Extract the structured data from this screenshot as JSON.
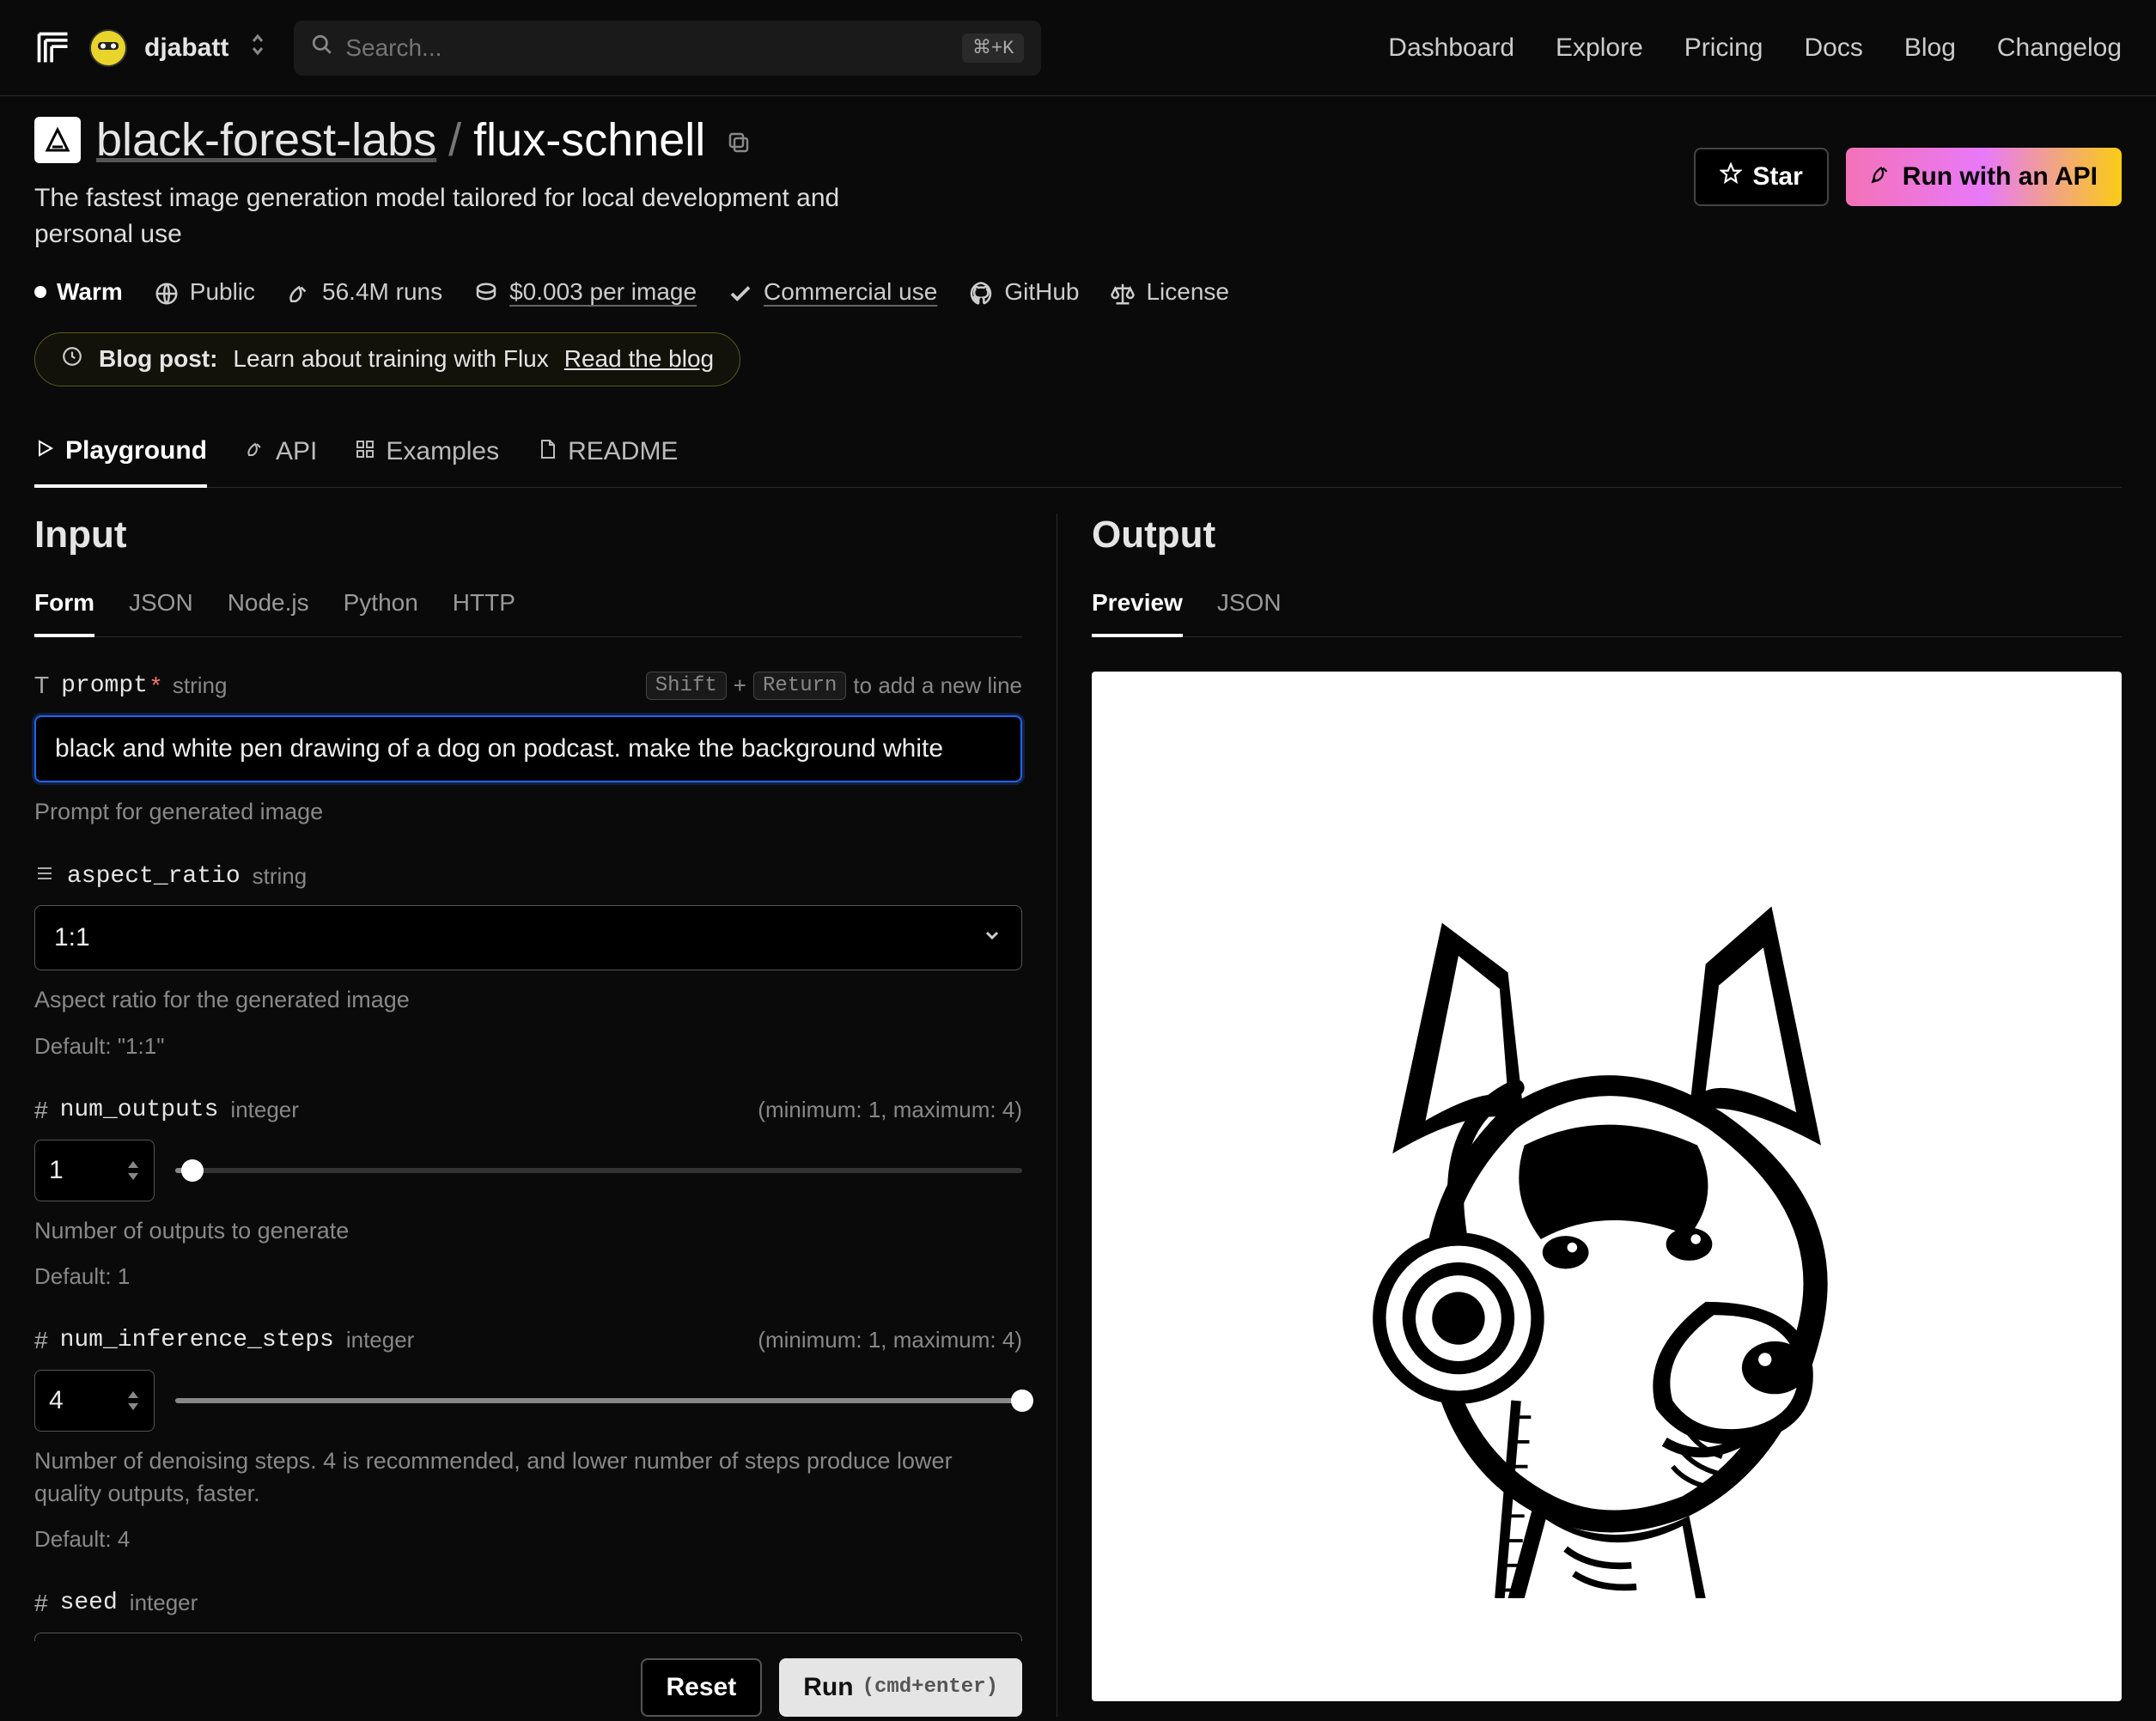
{
  "header": {
    "username": "djabatt",
    "search_placeholder": "Search...",
    "search_kbd": "⌘+K",
    "nav": [
      "Dashboard",
      "Explore",
      "Pricing",
      "Docs",
      "Blog",
      "Changelog"
    ]
  },
  "title": {
    "org": "black-forest-labs",
    "model": "flux-schnell",
    "subtitle": "The fastest image generation model tailored for local development and personal use"
  },
  "actions": {
    "star": "Star",
    "run_api": "Run with an API"
  },
  "meta": {
    "warm": "Warm",
    "visibility": "Public",
    "runs": "56.4M runs",
    "price": "$0.003 per image",
    "commercial": "Commercial use",
    "github": "GitHub",
    "license": "License"
  },
  "callout": {
    "label": "Blog post:",
    "text": "Learn about training with Flux",
    "link": "Read the blog"
  },
  "tabs": [
    "Playground",
    "API",
    "Examples",
    "README"
  ],
  "input": {
    "heading": "Input",
    "subtabs": [
      "Form",
      "JSON",
      "Node.js",
      "Python",
      "HTTP"
    ],
    "prompt": {
      "name": "prompt",
      "type": "string",
      "hint_pre": "Shift",
      "hint_mid": "+",
      "hint_key": "Return",
      "hint_post": "to add a new line",
      "value": "black and white pen drawing of a dog on podcast. make the background white",
      "help": "Prompt for generated image"
    },
    "aspect": {
      "name": "aspect_ratio",
      "type": "string",
      "value": "1:1",
      "help": "Aspect ratio for the generated image",
      "default": "Default: \"1:1\""
    },
    "numout": {
      "name": "num_outputs",
      "type": "integer",
      "range": "(minimum: 1, maximum: 4)",
      "value": "1",
      "help": "Number of outputs to generate",
      "default": "Default: 1"
    },
    "steps": {
      "name": "num_inference_steps",
      "type": "integer",
      "range": "(minimum: 1, maximum: 4)",
      "value": "4",
      "help": "Number of denoising steps. 4 is recommended, and lower number of steps produce lower quality outputs, faster.",
      "default": "Default: 4"
    },
    "seed": {
      "name": "seed",
      "type": "integer"
    }
  },
  "footer": {
    "reset": "Reset",
    "run": "Run",
    "run_hint": "(cmd+enter)"
  },
  "output": {
    "heading": "Output",
    "subtabs": [
      "Preview",
      "JSON"
    ]
  }
}
